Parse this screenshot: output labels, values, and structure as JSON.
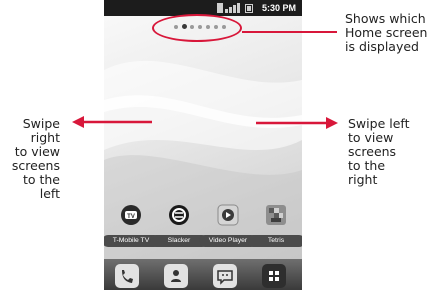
{
  "status_bar": {
    "time": "5:30 PM"
  },
  "home": {
    "page_count": 7,
    "active_page_index": 1,
    "apps": [
      {
        "label": "T-Mobile TV",
        "icon": "tv-icon"
      },
      {
        "label": "Slacker",
        "icon": "slacker-icon"
      },
      {
        "label": "Video Player",
        "icon": "video-player-icon"
      },
      {
        "label": "Tetris",
        "icon": "tetris-icon"
      }
    ],
    "dock": [
      {
        "icon": "phone-icon"
      },
      {
        "icon": "contacts-icon"
      },
      {
        "icon": "messaging-icon"
      },
      {
        "icon": "app-drawer-icon"
      }
    ]
  },
  "annotations": {
    "top_right": [
      "Shows which",
      "Home screen",
      "is displayed"
    ],
    "left": [
      "Swipe",
      "right",
      "to view",
      "screens",
      "to the",
      "left"
    ],
    "right": [
      "Swipe left",
      "to view",
      "screens",
      "to the",
      "right"
    ]
  },
  "colors": {
    "callout": "#d8173a",
    "label_bg": "#4b4b4b",
    "status_bar": "#1c1c1c"
  }
}
